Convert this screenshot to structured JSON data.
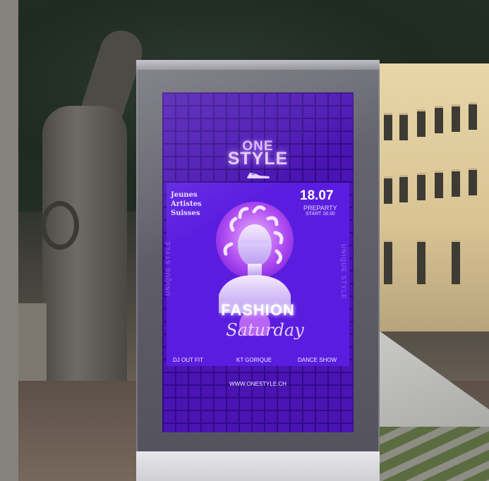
{
  "poster": {
    "logo_line1": "ONE",
    "logo_line2": "STYLE",
    "artists_line1": "Jeunes",
    "artists_line2": "Artistes",
    "artists_line3": "Suisses",
    "date": "18.07",
    "preparty": "PREPARTY",
    "start": "START 18:30",
    "headline": "FASHION",
    "subheadline": "Saturday",
    "side_left": "UNIQUE STYLE",
    "side_right": "UNIQUE STYLE",
    "lineup": [
      "DJ OUT FIT",
      "KT GORIQUE",
      "DANCE SHOW"
    ],
    "website": "WWW.ONESTYLE.CH"
  },
  "colors": {
    "poster_background": "#4a14b3",
    "poster_grid": "#2f0a82",
    "accent_glow": "#c795ff"
  },
  "icons": {
    "logo_shoe": "sneaker-icon",
    "statue": "medusa-bust-illustration"
  }
}
